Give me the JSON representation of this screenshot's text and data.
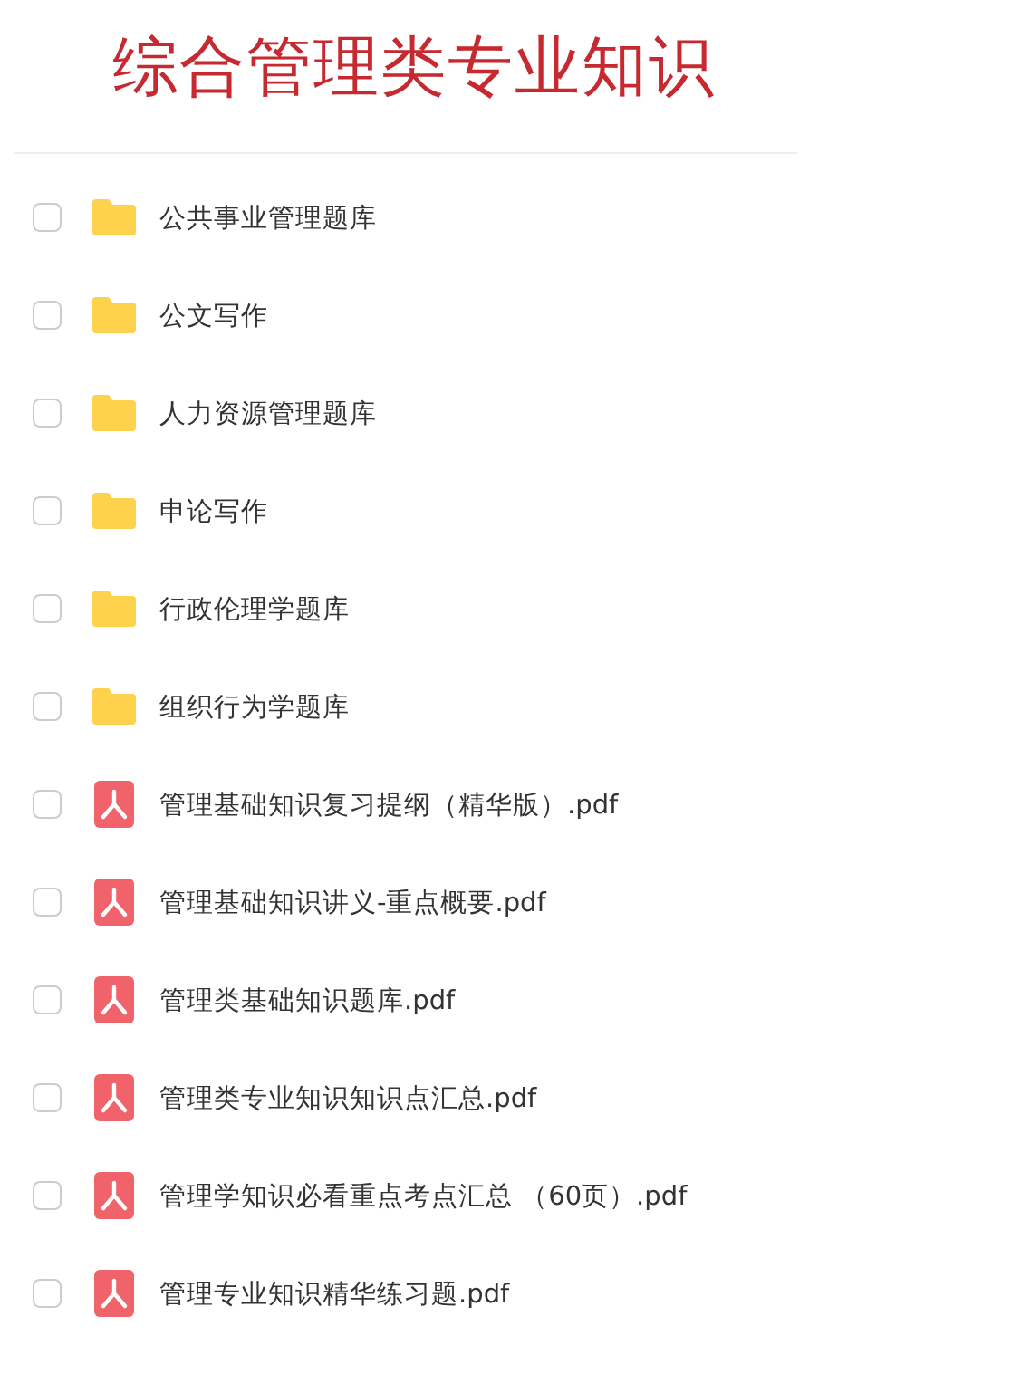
{
  "title": "综合管理类专业知识",
  "files": [
    {
      "kind": "folder",
      "name": "公共事业管理题库",
      "checked": false
    },
    {
      "kind": "folder",
      "name": "公文写作",
      "checked": false
    },
    {
      "kind": "folder",
      "name": "人力资源管理题库",
      "checked": false
    },
    {
      "kind": "folder",
      "name": "申论写作",
      "checked": false
    },
    {
      "kind": "folder",
      "name": "行政伦理学题库",
      "checked": false
    },
    {
      "kind": "folder",
      "name": "组织行为学题库",
      "checked": false
    },
    {
      "kind": "pdf",
      "name": "管理基础知识复习提纲（精华版）.pdf",
      "checked": false
    },
    {
      "kind": "pdf",
      "name": "管理基础知识讲义-重点概要.pdf",
      "checked": false
    },
    {
      "kind": "pdf",
      "name": "管理类基础知识题库.pdf",
      "checked": false
    },
    {
      "kind": "pdf",
      "name": "管理类专业知识知识点汇总.pdf",
      "checked": false
    },
    {
      "kind": "pdf",
      "name": "管理学知识必看重点考点汇总 （60页）.pdf",
      "checked": false
    },
    {
      "kind": "pdf",
      "name": "管理专业知识精华练习题.pdf",
      "checked": false
    }
  ]
}
